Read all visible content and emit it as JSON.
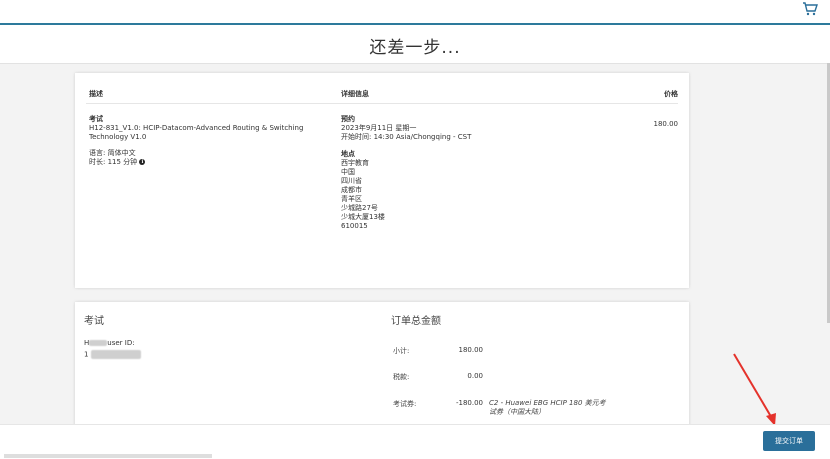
{
  "header": {
    "cart_icon": "cart-icon",
    "title": "还差一步..."
  },
  "details_table": {
    "headers": {
      "description": "描述",
      "details": "详细信息",
      "price": "价格"
    },
    "exam": {
      "label": "考试",
      "name": "H12-831_V1.0: HCIP-Datacom-Advanced Routing & Switching Technology V1.0",
      "language": "语言: 简体中文",
      "duration": "时长: 115 分钟"
    },
    "appointment": {
      "label": "预约",
      "date": "2023年9月11日 星期一",
      "start_time": "开始时间: 14:30 Asia/Chongqing - CST"
    },
    "location": {
      "label": "地点",
      "lines": [
        "西宇教育",
        "中国",
        "四川省",
        "成都市",
        "青羊区",
        "少城路27号",
        "少城大厦13楼",
        "610015"
      ]
    },
    "price": "180.00"
  },
  "candidate": {
    "title": "考试",
    "user_id_label_suffix": "user ID:",
    "user_id_prefix": "1"
  },
  "order_summary": {
    "title": "订单总金额",
    "rows": [
      {
        "label": "小计:",
        "value": "180.00",
        "note": ""
      },
      {
        "label": "税款:",
        "value": "0.00",
        "note": ""
      },
      {
        "label": "考试券:",
        "value": "-180.00",
        "note": "C2 - Huawei EBG HCIP 180 美元考试券（中国大陆）"
      }
    ]
  },
  "footer": {
    "submit_label": "提交订单"
  },
  "colors": {
    "accent": "#2a6f9a",
    "annotation_arrow": "#e4322b"
  }
}
